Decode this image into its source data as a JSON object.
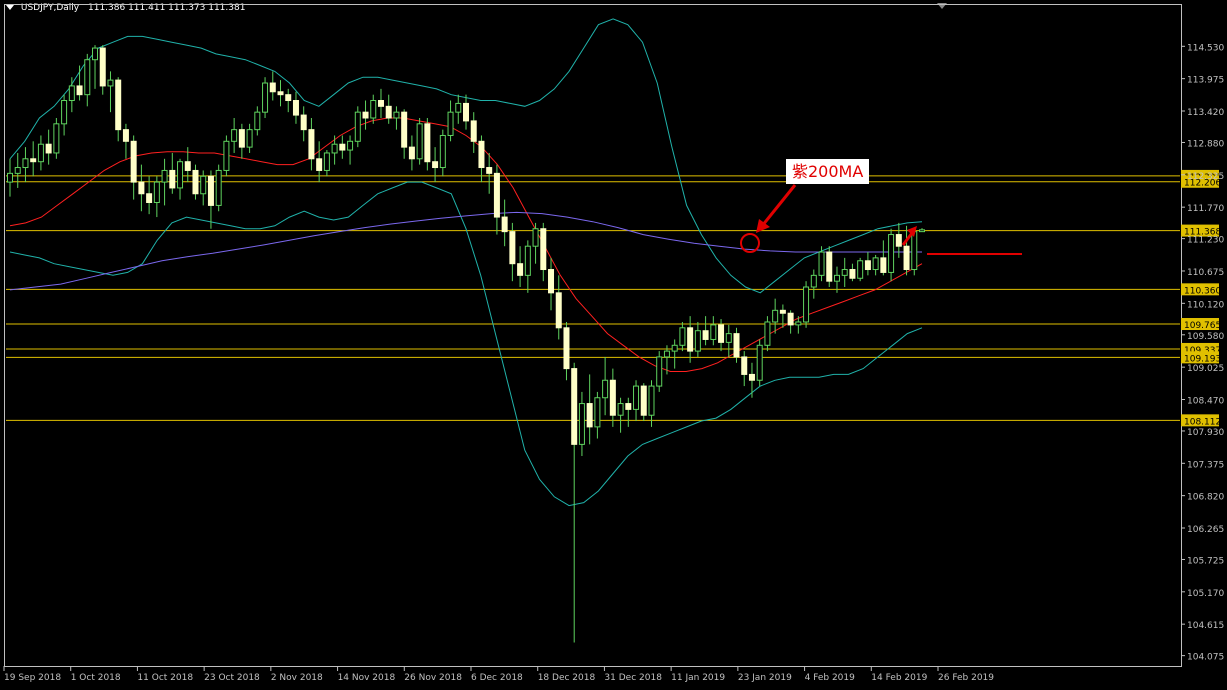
{
  "header": {
    "symbol_timeframe": "USDJPY,Daily",
    "ohlc": "111.386 111.411 111.373 111.381"
  },
  "annotation": {
    "label": "紫200MA"
  },
  "colors": {
    "background": "#000000",
    "axis": "#c0c0c0",
    "bull_candle": "#ffffc8",
    "bear_candle": "#ffffc8",
    "wick": "#5fd35f",
    "bollinger": "#20b2aa",
    "ma_red": "#ff2020",
    "ma_purple": "#7b68ee",
    "hline": "#e0c000",
    "price_label_bg": "#e0c000",
    "callout_red": "#e00000"
  },
  "chart_data": {
    "type": "candlestick",
    "title": "USDJPY,Daily",
    "ylim": [
      104.0,
      115.05
    ],
    "y_ticks": [
      "114.530",
      "113.975",
      "113.420",
      "112.880",
      "112.325",
      "111.770",
      "111.230",
      "110.675",
      "110.120",
      "109.580",
      "109.025",
      "108.470",
      "107.930",
      "107.375",
      "106.820",
      "106.265",
      "105.725",
      "105.170",
      "104.615",
      "104.075"
    ],
    "x_ticks": [
      "19 Sep 2018",
      "1 Oct 2018",
      "11 Oct 2018",
      "23 Oct 2018",
      "2 Nov 2018",
      "14 Nov 2018",
      "26 Nov 2018",
      "6 Dec 2018",
      "18 Dec 2018",
      "31 Dec 2018",
      "11 Jan 2019",
      "23 Jan 2019",
      "4 Feb 2019",
      "14 Feb 2019",
      "26 Feb 2019"
    ],
    "horizontal_levels": [
      "112.306",
      "112.206",
      "111.368",
      "110.360",
      "109.765",
      "109.337",
      "109.193",
      "108.112"
    ],
    "candles": [
      {
        "o": 112.2,
        "h": 112.6,
        "l": 111.95,
        "c": 112.35
      },
      {
        "o": 112.35,
        "h": 112.7,
        "l": 112.1,
        "c": 112.45
      },
      {
        "o": 112.45,
        "h": 112.8,
        "l": 112.2,
        "c": 112.6
      },
      {
        "o": 112.6,
        "h": 112.9,
        "l": 112.3,
        "c": 112.55
      },
      {
        "o": 112.55,
        "h": 113.0,
        "l": 112.4,
        "c": 112.85
      },
      {
        "o": 112.85,
        "h": 113.1,
        "l": 112.5,
        "c": 112.7
      },
      {
        "o": 112.7,
        "h": 113.3,
        "l": 112.6,
        "c": 113.2
      },
      {
        "o": 113.2,
        "h": 113.7,
        "l": 113.0,
        "c": 113.6
      },
      {
        "o": 113.6,
        "h": 114.0,
        "l": 113.4,
        "c": 113.85
      },
      {
        "o": 113.85,
        "h": 114.2,
        "l": 113.6,
        "c": 113.7
      },
      {
        "o": 113.7,
        "h": 114.4,
        "l": 113.5,
        "c": 114.3
      },
      {
        "o": 114.3,
        "h": 114.55,
        "l": 113.8,
        "c": 114.5
      },
      {
        "o": 114.5,
        "h": 114.55,
        "l": 113.7,
        "c": 113.85
      },
      {
        "o": 113.85,
        "h": 114.1,
        "l": 113.4,
        "c": 113.95
      },
      {
        "o": 113.95,
        "h": 114.0,
        "l": 112.9,
        "c": 113.1
      },
      {
        "o": 113.1,
        "h": 113.2,
        "l": 112.6,
        "c": 112.9
      },
      {
        "o": 112.9,
        "h": 113.0,
        "l": 111.9,
        "c": 112.2
      },
      {
        "o": 112.2,
        "h": 112.5,
        "l": 111.7,
        "c": 112.0
      },
      {
        "o": 112.0,
        "h": 112.3,
        "l": 111.65,
        "c": 111.85
      },
      {
        "o": 111.85,
        "h": 112.3,
        "l": 111.6,
        "c": 112.2
      },
      {
        "o": 112.2,
        "h": 112.6,
        "l": 111.8,
        "c": 112.4
      },
      {
        "o": 112.4,
        "h": 112.7,
        "l": 112.0,
        "c": 112.1
      },
      {
        "o": 112.1,
        "h": 112.6,
        "l": 111.9,
        "c": 112.55
      },
      {
        "o": 112.55,
        "h": 112.8,
        "l": 112.2,
        "c": 112.4
      },
      {
        "o": 112.4,
        "h": 112.5,
        "l": 111.9,
        "c": 112.0
      },
      {
        "o": 112.0,
        "h": 112.4,
        "l": 111.8,
        "c": 112.3
      },
      {
        "o": 112.3,
        "h": 112.4,
        "l": 111.4,
        "c": 111.8
      },
      {
        "o": 111.8,
        "h": 112.5,
        "l": 111.7,
        "c": 112.4
      },
      {
        "o": 112.4,
        "h": 113.0,
        "l": 112.3,
        "c": 112.9
      },
      {
        "o": 112.9,
        "h": 113.3,
        "l": 112.7,
        "c": 113.1
      },
      {
        "o": 113.1,
        "h": 113.2,
        "l": 112.6,
        "c": 112.8
      },
      {
        "o": 112.8,
        "h": 113.2,
        "l": 112.7,
        "c": 113.1
      },
      {
        "o": 113.1,
        "h": 113.5,
        "l": 113.0,
        "c": 113.4
      },
      {
        "o": 113.4,
        "h": 114.0,
        "l": 113.3,
        "c": 113.9
      },
      {
        "o": 113.9,
        "h": 114.1,
        "l": 113.6,
        "c": 113.75
      },
      {
        "o": 113.75,
        "h": 113.95,
        "l": 113.5,
        "c": 113.7
      },
      {
        "o": 113.7,
        "h": 113.8,
        "l": 113.4,
        "c": 113.6
      },
      {
        "o": 113.6,
        "h": 113.75,
        "l": 113.2,
        "c": 113.35
      },
      {
        "o": 113.35,
        "h": 113.5,
        "l": 112.9,
        "c": 113.1
      },
      {
        "o": 113.1,
        "h": 113.3,
        "l": 112.4,
        "c": 112.6
      },
      {
        "o": 112.6,
        "h": 112.9,
        "l": 112.2,
        "c": 112.4
      },
      {
        "o": 112.4,
        "h": 112.75,
        "l": 112.3,
        "c": 112.7
      },
      {
        "o": 112.7,
        "h": 113.0,
        "l": 112.5,
        "c": 112.85
      },
      {
        "o": 112.85,
        "h": 113.0,
        "l": 112.6,
        "c": 112.75
      },
      {
        "o": 112.75,
        "h": 113.0,
        "l": 112.5,
        "c": 112.9
      },
      {
        "o": 112.9,
        "h": 113.5,
        "l": 112.8,
        "c": 113.4
      },
      {
        "o": 113.4,
        "h": 113.6,
        "l": 113.1,
        "c": 113.3
      },
      {
        "o": 113.3,
        "h": 113.7,
        "l": 113.2,
        "c": 113.6
      },
      {
        "o": 113.6,
        "h": 113.8,
        "l": 113.3,
        "c": 113.5
      },
      {
        "o": 113.5,
        "h": 113.7,
        "l": 113.2,
        "c": 113.3
      },
      {
        "o": 113.3,
        "h": 113.5,
        "l": 113.1,
        "c": 113.4
      },
      {
        "o": 113.4,
        "h": 113.45,
        "l": 112.6,
        "c": 112.8
      },
      {
        "o": 112.8,
        "h": 113.0,
        "l": 112.4,
        "c": 112.6
      },
      {
        "o": 112.6,
        "h": 113.3,
        "l": 112.5,
        "c": 113.2
      },
      {
        "o": 113.2,
        "h": 113.3,
        "l": 112.4,
        "c": 112.55
      },
      {
        "o": 112.55,
        "h": 112.8,
        "l": 112.2,
        "c": 112.45
      },
      {
        "o": 112.45,
        "h": 113.1,
        "l": 112.3,
        "c": 113.0
      },
      {
        "o": 113.0,
        "h": 113.6,
        "l": 112.9,
        "c": 113.4
      },
      {
        "o": 113.4,
        "h": 113.7,
        "l": 113.2,
        "c": 113.55
      },
      {
        "o": 113.55,
        "h": 113.7,
        "l": 113.1,
        "c": 113.25
      },
      {
        "o": 113.25,
        "h": 113.4,
        "l": 112.7,
        "c": 112.9
      },
      {
        "o": 112.9,
        "h": 113.0,
        "l": 112.2,
        "c": 112.45
      },
      {
        "o": 112.45,
        "h": 112.7,
        "l": 112.0,
        "c": 112.35
      },
      {
        "o": 112.35,
        "h": 112.5,
        "l": 111.3,
        "c": 111.6
      },
      {
        "o": 111.6,
        "h": 111.9,
        "l": 111.1,
        "c": 111.35
      },
      {
        "o": 111.35,
        "h": 111.5,
        "l": 110.5,
        "c": 110.8
      },
      {
        "o": 110.8,
        "h": 111.1,
        "l": 110.4,
        "c": 110.6
      },
      {
        "o": 110.6,
        "h": 111.2,
        "l": 110.3,
        "c": 111.1
      },
      {
        "o": 111.1,
        "h": 111.5,
        "l": 110.8,
        "c": 111.4
      },
      {
        "o": 111.4,
        "h": 111.5,
        "l": 110.5,
        "c": 110.7
      },
      {
        "o": 110.7,
        "h": 110.9,
        "l": 110.0,
        "c": 110.3
      },
      {
        "o": 110.3,
        "h": 110.6,
        "l": 109.5,
        "c": 109.7
      },
      {
        "o": 109.7,
        "h": 109.8,
        "l": 108.8,
        "c": 109.0
      },
      {
        "o": 109.0,
        "h": 109.1,
        "l": 104.3,
        "c": 107.7
      },
      {
        "o": 107.7,
        "h": 108.6,
        "l": 107.5,
        "c": 108.4
      },
      {
        "o": 108.4,
        "h": 108.9,
        "l": 107.7,
        "c": 108.0
      },
      {
        "o": 108.0,
        "h": 108.6,
        "l": 107.8,
        "c": 108.5
      },
      {
        "o": 108.5,
        "h": 109.2,
        "l": 108.2,
        "c": 108.8
      },
      {
        "o": 108.8,
        "h": 109.0,
        "l": 108.0,
        "c": 108.2
      },
      {
        "o": 108.2,
        "h": 108.5,
        "l": 107.9,
        "c": 108.4
      },
      {
        "o": 108.4,
        "h": 108.5,
        "l": 108.0,
        "c": 108.3
      },
      {
        "o": 108.3,
        "h": 108.8,
        "l": 108.1,
        "c": 108.7
      },
      {
        "o": 108.7,
        "h": 108.75,
        "l": 108.1,
        "c": 108.2
      },
      {
        "o": 108.2,
        "h": 108.8,
        "l": 108.0,
        "c": 108.7
      },
      {
        "o": 108.7,
        "h": 109.3,
        "l": 108.6,
        "c": 109.2
      },
      {
        "o": 109.2,
        "h": 109.4,
        "l": 108.9,
        "c": 109.3
      },
      {
        "o": 109.3,
        "h": 109.5,
        "l": 109.0,
        "c": 109.4
      },
      {
        "o": 109.4,
        "h": 109.8,
        "l": 109.3,
        "c": 109.7
      },
      {
        "o": 109.7,
        "h": 109.9,
        "l": 109.1,
        "c": 109.3
      },
      {
        "o": 109.3,
        "h": 109.8,
        "l": 109.2,
        "c": 109.65
      },
      {
        "o": 109.65,
        "h": 109.9,
        "l": 109.4,
        "c": 109.5
      },
      {
        "o": 109.5,
        "h": 109.9,
        "l": 109.4,
        "c": 109.75
      },
      {
        "o": 109.75,
        "h": 109.85,
        "l": 109.3,
        "c": 109.45
      },
      {
        "o": 109.45,
        "h": 109.75,
        "l": 109.2,
        "c": 109.6
      },
      {
        "o": 109.6,
        "h": 109.7,
        "l": 109.1,
        "c": 109.2
      },
      {
        "o": 109.2,
        "h": 109.3,
        "l": 108.7,
        "c": 108.9
      },
      {
        "o": 108.9,
        "h": 109.1,
        "l": 108.5,
        "c": 108.8
      },
      {
        "o": 108.8,
        "h": 109.5,
        "l": 108.7,
        "c": 109.4
      },
      {
        "o": 109.4,
        "h": 109.9,
        "l": 109.3,
        "c": 109.8
      },
      {
        "o": 109.8,
        "h": 110.2,
        "l": 109.6,
        "c": 110.0
      },
      {
        "o": 110.0,
        "h": 110.1,
        "l": 109.7,
        "c": 109.95
      },
      {
        "o": 109.95,
        "h": 110.0,
        "l": 109.6,
        "c": 109.75
      },
      {
        "o": 109.75,
        "h": 109.9,
        "l": 109.6,
        "c": 109.8
      },
      {
        "o": 109.8,
        "h": 110.5,
        "l": 109.7,
        "c": 110.4
      },
      {
        "o": 110.4,
        "h": 110.7,
        "l": 110.2,
        "c": 110.6
      },
      {
        "o": 110.6,
        "h": 111.1,
        "l": 110.5,
        "c": 111.0
      },
      {
        "o": 111.0,
        "h": 111.1,
        "l": 110.4,
        "c": 110.5
      },
      {
        "o": 110.5,
        "h": 110.75,
        "l": 110.3,
        "c": 110.6
      },
      {
        "o": 110.6,
        "h": 110.9,
        "l": 110.4,
        "c": 110.7
      },
      {
        "o": 110.7,
        "h": 110.8,
        "l": 110.5,
        "c": 110.55
      },
      {
        "o": 110.55,
        "h": 110.9,
        "l": 110.5,
        "c": 110.85
      },
      {
        "o": 110.85,
        "h": 111.0,
        "l": 110.6,
        "c": 110.7
      },
      {
        "o": 110.7,
        "h": 110.95,
        "l": 110.6,
        "c": 110.9
      },
      {
        "o": 110.9,
        "h": 111.2,
        "l": 110.6,
        "c": 110.65
      },
      {
        "o": 110.65,
        "h": 111.4,
        "l": 110.5,
        "c": 111.3
      },
      {
        "o": 111.3,
        "h": 111.5,
        "l": 110.9,
        "c": 111.1
      },
      {
        "o": 111.1,
        "h": 111.45,
        "l": 110.6,
        "c": 110.7
      },
      {
        "o": 110.7,
        "h": 111.4,
        "l": 110.6,
        "c": 111.35
      },
      {
        "o": 111.35,
        "h": 111.41,
        "l": 111.37,
        "c": 111.381
      }
    ],
    "bollinger_upper": [
      112.6,
      112.9,
      113.3,
      113.5,
      113.8,
      114.2,
      114.5,
      114.6,
      114.7,
      114.7,
      114.65,
      114.6,
      114.55,
      114.5,
      114.4,
      114.35,
      114.3,
      114.2,
      114.1,
      113.9,
      113.6,
      113.5,
      113.7,
      113.9,
      114.0,
      114.0,
      113.95,
      113.9,
      113.85,
      113.8,
      113.7,
      113.65,
      113.6,
      113.6,
      113.55,
      113.5,
      113.6,
      113.8,
      114.1,
      114.5,
      114.9,
      115.0,
      114.9,
      114.6,
      113.9,
      112.8,
      111.8,
      111.3,
      110.9,
      110.6,
      110.4,
      110.3,
      110.5,
      110.7,
      110.9,
      111.0,
      111.1,
      111.2,
      111.3,
      111.4,
      111.45,
      111.5,
      111.52
    ],
    "bollinger_lower": [
      111.0,
      110.95,
      110.9,
      110.8,
      110.75,
      110.7,
      110.65,
      110.6,
      110.65,
      110.8,
      111.2,
      111.5,
      111.6,
      111.55,
      111.5,
      111.45,
      111.4,
      111.4,
      111.45,
      111.6,
      111.7,
      111.6,
      111.55,
      111.6,
      111.8,
      112.0,
      112.1,
      112.2,
      112.2,
      112.1,
      112.0,
      111.4,
      110.6,
      109.6,
      108.6,
      107.6,
      107.1,
      106.8,
      106.65,
      106.7,
      106.9,
      107.2,
      107.5,
      107.7,
      107.8,
      107.9,
      108.0,
      108.1,
      108.15,
      108.3,
      108.5,
      108.7,
      108.8,
      108.85,
      108.85,
      108.85,
      108.9,
      108.9,
      109.0,
      109.2,
      109.4,
      109.6,
      109.7
    ],
    "ma_red": [
      111.45,
      111.5,
      111.6,
      111.8,
      112.0,
      112.2,
      112.4,
      112.55,
      112.65,
      112.7,
      112.72,
      112.72,
      112.7,
      112.7,
      112.65,
      112.6,
      112.55,
      112.5,
      112.5,
      112.6,
      112.8,
      113.0,
      113.15,
      113.25,
      113.3,
      113.3,
      113.25,
      113.2,
      113.15,
      113.0,
      112.8,
      112.5,
      112.1,
      111.6,
      111.1,
      110.6,
      110.2,
      109.9,
      109.6,
      109.4,
      109.2,
      109.05,
      108.95,
      108.95,
      109.0,
      109.1,
      109.25,
      109.4,
      109.55,
      109.7,
      109.85,
      109.95,
      110.05,
      110.15,
      110.25,
      110.35,
      110.5,
      110.65,
      110.8
    ],
    "ma_purple": [
      110.35,
      110.4,
      110.45,
      110.55,
      110.65,
      110.75,
      110.85,
      110.92,
      110.98,
      111.05,
      111.12,
      111.2,
      111.28,
      111.35,
      111.42,
      111.48,
      111.53,
      111.58,
      111.62,
      111.66,
      111.68,
      111.66,
      111.6,
      111.52,
      111.42,
      111.3,
      111.22,
      111.15,
      111.1,
      111.05,
      111.02,
      111.0,
      111.0,
      111.0,
      111.0,
      111.0,
      111.0
    ]
  }
}
